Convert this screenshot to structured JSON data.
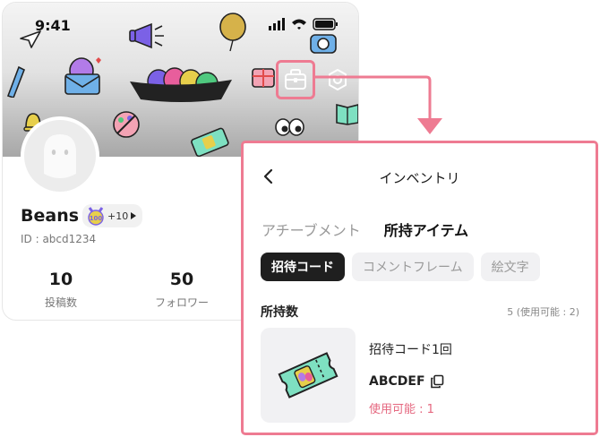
{
  "status_bar": {
    "time": "9:41"
  },
  "profile": {
    "name": "Beans",
    "badge_extra": "+10",
    "user_id": "ID : abcd1234",
    "stats": [
      {
        "value": "10",
        "label": "投稿数"
      },
      {
        "value": "50",
        "label": "フォロワー"
      }
    ],
    "badge_text": "100"
  },
  "inventory": {
    "title": "インベントリ",
    "tabs": [
      {
        "label": "アチーブメント",
        "active": false
      },
      {
        "label": "所持アイテム",
        "active": true
      }
    ],
    "chips": [
      {
        "label": "招待コード",
        "active": true
      },
      {
        "label": "コメントフレーム",
        "active": false
      },
      {
        "label": "絵文字",
        "active": false
      }
    ],
    "count_label": "所持数",
    "count_value": "5 (使用可能 : 2)",
    "item": {
      "name": "招待コード1回",
      "code": "ABCDEF",
      "available": "使用可能 : 1"
    }
  },
  "colors": {
    "highlight": "#ee7b92",
    "available_text": "#e5677f",
    "active_chip": "#1f1f1f"
  },
  "icons": [
    "shop-icon",
    "settings-icon",
    "back-arrow-icon",
    "copy-icon",
    "ticket-icon",
    "play-triangle-icon"
  ]
}
